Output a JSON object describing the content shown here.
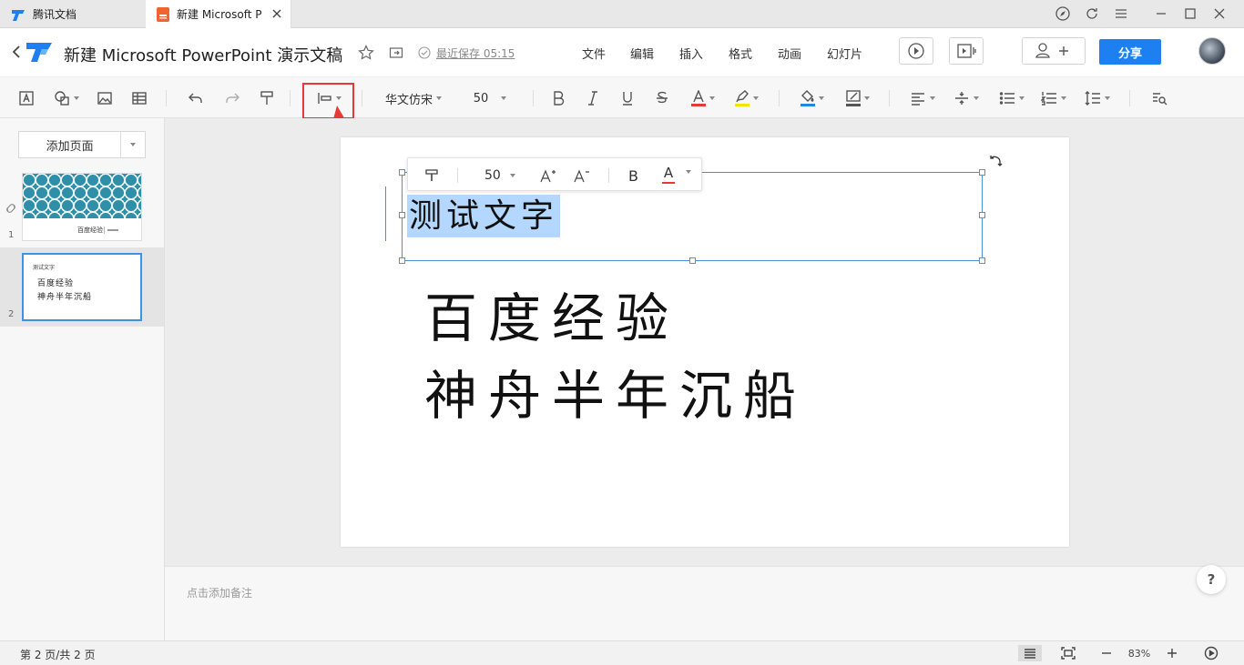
{
  "tabs": [
    {
      "label": "腾讯文档"
    },
    {
      "label": "新建 Microsoft P"
    }
  ],
  "header": {
    "title": "新建 Microsoft PowerPoint 演示文稿",
    "save_status": "最近保存 05:15",
    "menu": [
      "文件",
      "编辑",
      "插入",
      "格式",
      "动画",
      "幻灯片"
    ],
    "share_label": "分享"
  },
  "toolbar": {
    "font_family": "华文仿宋",
    "font_size": "50",
    "font_color": "#e53935",
    "highlight_color": "#f2e400",
    "fill_color": "#1e88e5",
    "border_color": "#555555"
  },
  "left_panel": {
    "add_page_label": "添加页面",
    "slides": [
      {
        "number": "1",
        "line1": "百度经验"
      },
      {
        "number": "2",
        "line0": "测试文字",
        "line1": "百度经验",
        "line2": "神舟半年沉船"
      }
    ]
  },
  "slide": {
    "selected_text": "测试文字",
    "body_lines": [
      "百度经验",
      "神舟半年沉船"
    ]
  },
  "floating_toolbar": {
    "font_size": "50",
    "bold_label": "B",
    "font_color_label": "A"
  },
  "notes": {
    "placeholder": "点击添加备注"
  },
  "status": {
    "page_indicator": "第 2 页/共 2 页",
    "zoom": "83%"
  },
  "help_label": "?"
}
